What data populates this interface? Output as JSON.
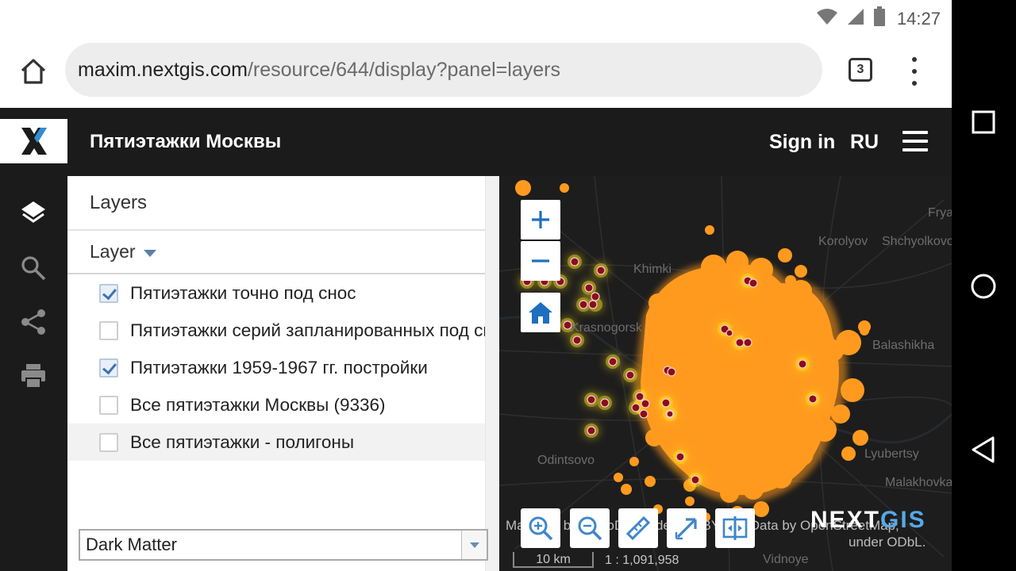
{
  "status_bar": {
    "time": "14:27"
  },
  "browser": {
    "url_host": "maxim.nextgis.com",
    "url_path": "/resource/644/display?panel=layers",
    "tab_count": "3"
  },
  "header": {
    "title": "Пятиэтажки Москвы",
    "sign_in": "Sign in",
    "language": "RU"
  },
  "layers_panel": {
    "title": "Layers",
    "column_header": "Layer",
    "layers": [
      {
        "label": "Пятиэтажки точно под снос",
        "checked": true
      },
      {
        "label": "Пятиэтажки серий запланированных под снос",
        "checked": false
      },
      {
        "label": "Пятиэтажки 1959-1967 гг. постройки",
        "checked": true
      },
      {
        "label": "Все пятиэтажки Москвы (9336)",
        "checked": false
      },
      {
        "label": "Все пятиэтажки - полигоны",
        "checked": false
      }
    ],
    "basemap": "Dark Matter"
  },
  "map": {
    "place_labels": [
      "Khimki",
      "Korolyov",
      "Shchyolkovo",
      "Fryazino",
      "Krasnogorsk",
      "Balashikha",
      "Odintsovo",
      "Lyubertsy",
      "Malakhovka",
      "Vidnoye"
    ],
    "attribution_line1": "Map tiles by CartoDB, under CC BY 3.0. Data by OpenStreetMap,",
    "attribution_line2": "under ODbL.",
    "scale_label": "10 km",
    "scale_ratio": "1 : 1,091,958",
    "logo_next": "NEXT",
    "logo_gis": "GIS",
    "colors": {
      "buildings": "#ff9a1f",
      "points": "#8c0d1c",
      "background": "#1d1d1d"
    }
  }
}
